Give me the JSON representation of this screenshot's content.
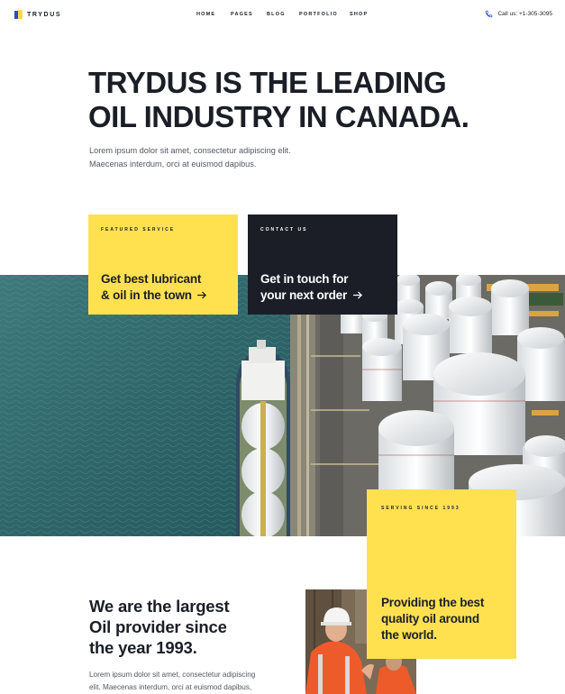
{
  "brand": {
    "name": "TRYDUS"
  },
  "nav": {
    "items": [
      "HOME",
      "PAGES",
      "BLOG",
      "PORTFOLIO",
      "SHOP"
    ]
  },
  "header": {
    "call_text": "Call us: +1-305-3095"
  },
  "hero": {
    "title_line1": "TRYDUS IS THE LEADING",
    "title_line2": "OIL INDUSTRY IN CANADA.",
    "desc_line1": "Lorem ipsum dolor sit amet, consectetur adipiscing elit.",
    "desc_line2": "Maecenas interdum, orci at euismod dapibus."
  },
  "cards": {
    "featured": {
      "kicker": "FEATURED SERVICE",
      "line1": "Get best lubricant",
      "line2": "& oil in the town"
    },
    "contact": {
      "kicker": "CONTACT US",
      "line1": "Get in touch for",
      "line2": "your next order"
    }
  },
  "serving": {
    "kicker": "SERVING SINCE 1993",
    "line1": "Providing the best",
    "line2": "quality oil around",
    "line3": "the world."
  },
  "about": {
    "title_line1": "We are the largest",
    "title_line2": "Oil provider since",
    "title_line3": "the year 1993.",
    "desc_line1": "Lorem ipsum dolor sit amet, consectetur adipiscing",
    "desc_line2": "elit. Maecenas interdum, orci at euismod dapibus,"
  },
  "icons": {
    "arrow": "arrow-right-icon",
    "phone": "phone-icon"
  },
  "colors": {
    "accent": "#ffe150",
    "dark": "#1b1e27",
    "phone_icon": "#2a4bd7"
  }
}
